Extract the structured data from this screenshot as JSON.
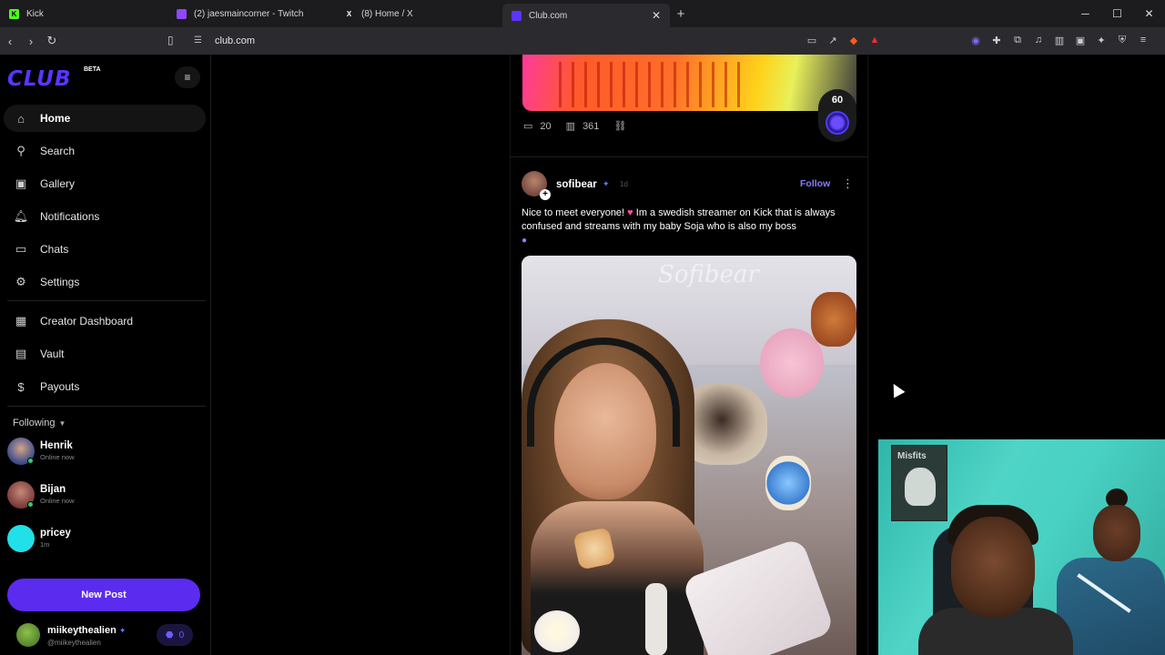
{
  "browser": {
    "tabs": [
      {
        "title": "Kick",
        "fav_color": "#53fc18",
        "fav_glyph": "K"
      },
      {
        "title": "(2) jaesmaincorner - Twitch",
        "fav_color": "#9146ff",
        "fav_glyph": ""
      },
      {
        "title": "(8) Home / X",
        "fav_color": "#ffffff",
        "fav_glyph": "X"
      },
      {
        "title": "Club.com",
        "fav_color": "#5b35ff",
        "fav_glyph": "",
        "active": true
      }
    ],
    "url": "club.com"
  },
  "sidebar": {
    "logo": "CLUB",
    "beta": "BETA",
    "nav": [
      {
        "label": "Home",
        "icon": "home-icon",
        "glyph": "⌂"
      },
      {
        "label": "Search",
        "icon": "search-icon",
        "glyph": "⚲"
      },
      {
        "label": "Gallery",
        "icon": "gallery-icon",
        "glyph": "▣"
      },
      {
        "label": "Notifications",
        "icon": "bell-icon",
        "glyph": "♫"
      },
      {
        "label": "Chats",
        "icon": "chat-icon",
        "glyph": "▭"
      },
      {
        "label": "Settings",
        "icon": "gear-icon",
        "glyph": "⚙"
      },
      {
        "label": "Creator Dashboard",
        "icon": "dashboard-icon",
        "glyph": "▦"
      },
      {
        "label": "Vault",
        "icon": "vault-icon",
        "glyph": "▤"
      },
      {
        "label": "Payouts",
        "icon": "payouts-icon",
        "glyph": "$"
      }
    ],
    "following_label": "Following",
    "friends": [
      {
        "name": "Henrik",
        "status": "Online now",
        "avatar_color": "#3b4a8a",
        "online": true
      },
      {
        "name": "Bijan",
        "status": "Online now",
        "avatar_color": "#7a3a3a",
        "online": true
      },
      {
        "name": "pricey",
        "status": "1m",
        "avatar_color": "#22e0e8",
        "online": false
      }
    ],
    "new_post_label": "New Post",
    "me": {
      "name": "miikeythealien",
      "handle": "@miikeythealien",
      "points": "0"
    }
  },
  "feed": {
    "prev_post": {
      "comments": "20",
      "views": "361",
      "badge_count": "60"
    },
    "post": {
      "author": "sofibear",
      "time": "1d",
      "follow_label": "Follow",
      "text_part1": "Nice to meet everyone! ",
      "text_part2": " Im a swedish streamer on Kick that is always confused and streams with my baby Soja who is also my boss",
      "watermark": "Sofibear"
    }
  },
  "webcam": {
    "poster_text": "Misfits"
  },
  "colors": {
    "accent": "#5b2bf0",
    "brand": "#5b35ff",
    "follow": "#8a7bff"
  }
}
